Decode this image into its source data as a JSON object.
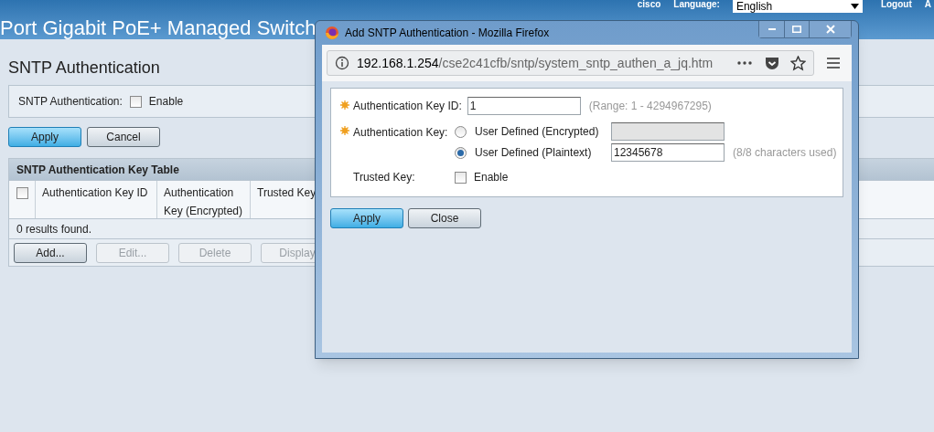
{
  "header": {
    "title": "Port Gigabit PoE+ Managed Switch",
    "brand": "cisco",
    "language_label": "Language:",
    "language": "English",
    "logout": "Logout",
    "cut_link": "A"
  },
  "page": {
    "title": "SNTP Authentication",
    "setting": {
      "label": "SNTP Authentication:",
      "option": "Enable",
      "checked": false
    },
    "buttons": [
      {
        "label": "Apply",
        "kind": "primary"
      },
      {
        "label": "Cancel",
        "kind": "normal"
      }
    ],
    "table": {
      "title": "SNTP Authentication Key Table",
      "select_all": false,
      "columns": [
        "Authentication Key ID",
        "Authentication Key (Encrypted)",
        "Trusted Key"
      ],
      "status": "0 results found.",
      "buttons": [
        {
          "label": "Add...",
          "disabled": false
        },
        {
          "label": "Edit...",
          "disabled": true
        },
        {
          "label": "Delete",
          "disabled": true
        },
        {
          "label": "Display",
          "disabled": true
        }
      ]
    }
  },
  "dialog": {
    "title": "Add SNTP Authentication - Mozilla Firefox",
    "url_host": "192.168.1.254",
    "url_path": "/cse2c41cfb/sntp/system_sntp_authen_a_jq.htm",
    "key_id": {
      "label": "Authentication Key ID:",
      "value": "1",
      "hint": "(Range: 1 - 4294967295)"
    },
    "key": {
      "label": "Authentication Key:",
      "options": [
        {
          "label": "User Defined (Encrypted)",
          "selected": false,
          "disabled": true
        },
        {
          "label": "User Defined (Plaintext)",
          "selected": true,
          "value": "12345678",
          "hint": "(8/8 characters used)",
          "disabled": false
        }
      ]
    },
    "trusted": {
      "label": "Trusted Key:",
      "option": "Enable",
      "checked": false
    },
    "buttons": [
      {
        "label": "Apply",
        "kind": "primary"
      },
      {
        "label": "Close",
        "kind": "normal"
      }
    ]
  }
}
